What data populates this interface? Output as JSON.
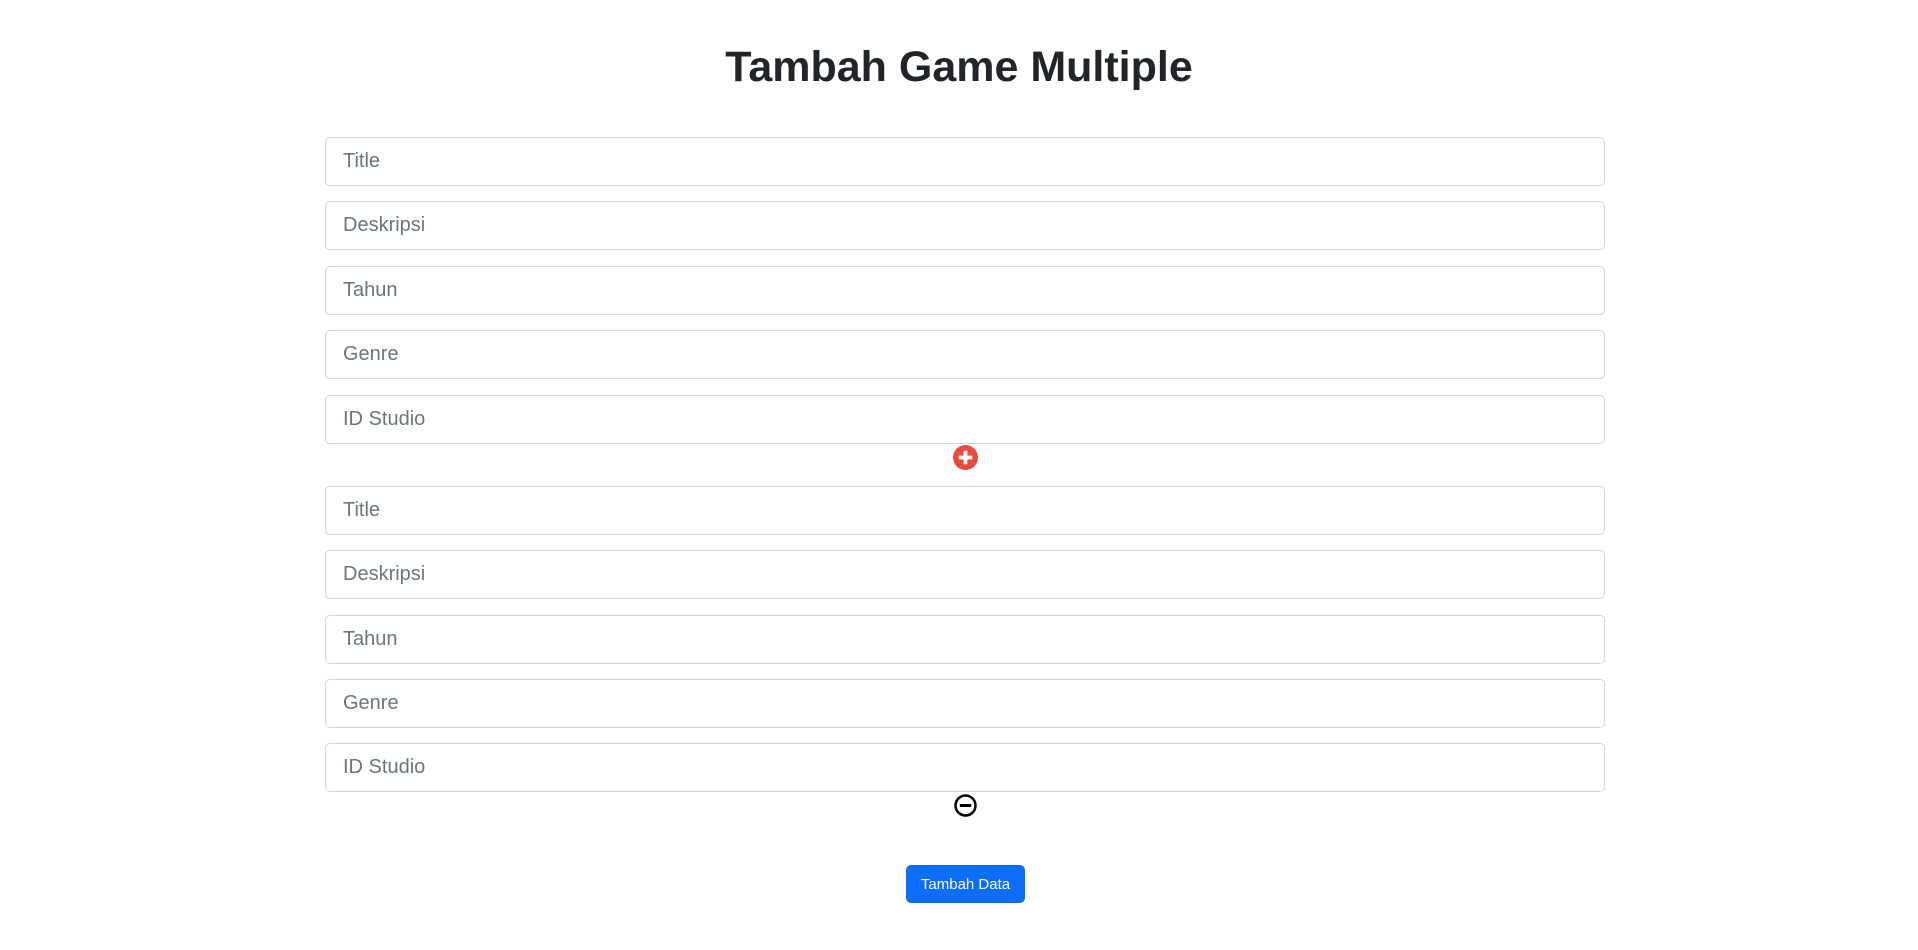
{
  "page": {
    "title": "Tambah Game Multiple"
  },
  "groups": [
    {
      "fields": [
        {
          "placeholder": "Title",
          "value": ""
        },
        {
          "placeholder": "Deskripsi",
          "value": ""
        },
        {
          "placeholder": "Tahun",
          "value": ""
        },
        {
          "placeholder": "Genre",
          "value": ""
        },
        {
          "placeholder": "ID Studio",
          "value": ""
        }
      ],
      "action_icon": "plus-circle-icon"
    },
    {
      "fields": [
        {
          "placeholder": "Title",
          "value": ""
        },
        {
          "placeholder": "Deskripsi",
          "value": ""
        },
        {
          "placeholder": "Tahun",
          "value": ""
        },
        {
          "placeholder": "Genre",
          "value": ""
        },
        {
          "placeholder": "ID Studio",
          "value": ""
        }
      ],
      "action_icon": "minus-circle-icon"
    }
  ],
  "submit": {
    "label": "Tambah Data"
  },
  "colors": {
    "add_icon": "#e74c3c",
    "remove_icon": "#000000",
    "primary_button": "#0d6efd",
    "input_border": "#ced4da",
    "placeholder": "#6c757d",
    "title": "#212529"
  }
}
